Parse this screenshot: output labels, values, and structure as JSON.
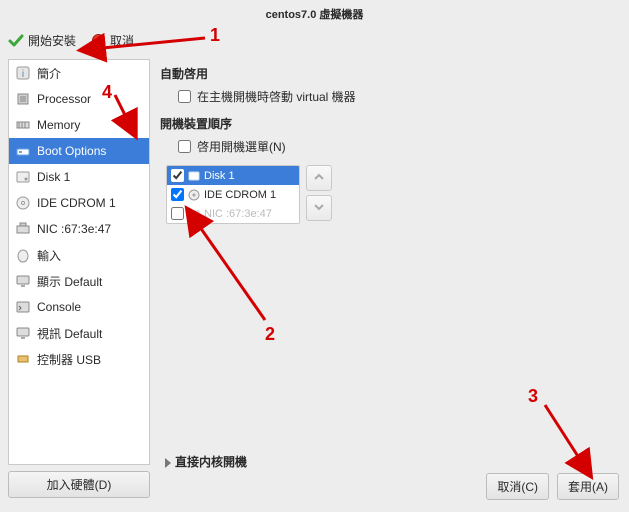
{
  "title": "centos7.0 虛擬機器",
  "toolbar": {
    "begin_install": "開始安裝",
    "cancel": "取消"
  },
  "sidebar": {
    "items": [
      {
        "label": "簡介"
      },
      {
        "label": "Processor"
      },
      {
        "label": "Memory"
      },
      {
        "label": "Boot Options"
      },
      {
        "label": "Disk 1"
      },
      {
        "label": "IDE CDROM 1"
      },
      {
        "label": "NIC :67:3e:47"
      },
      {
        "label": "輸入"
      },
      {
        "label": "顯示 Default"
      },
      {
        "label": "Console"
      },
      {
        "label": "視訊 Default"
      },
      {
        "label": "控制器 USB"
      }
    ],
    "add_hardware": "加入硬體(D)"
  },
  "autostart": {
    "title": "自動啓用",
    "checkbox_label": "在主機開機時啓動 virtual 機器",
    "checked": false
  },
  "bootorder": {
    "title": "開機裝置順序",
    "enable_menu_label": "啓用開機選單(N)",
    "enable_menu_checked": false,
    "items": [
      {
        "label": "Disk 1",
        "checked": true,
        "selected": true
      },
      {
        "label": "IDE CDROM 1",
        "checked": true,
        "selected": false
      },
      {
        "label": "NIC :67:3e:47",
        "checked": false,
        "selected": false,
        "disabled": true
      }
    ]
  },
  "direct_kernel": "直接内核開機",
  "footer": {
    "cancel": "取消(C)",
    "apply": "套用(A)"
  },
  "annotations": {
    "n1": "1",
    "n2": "2",
    "n3": "3",
    "n4": "4"
  }
}
